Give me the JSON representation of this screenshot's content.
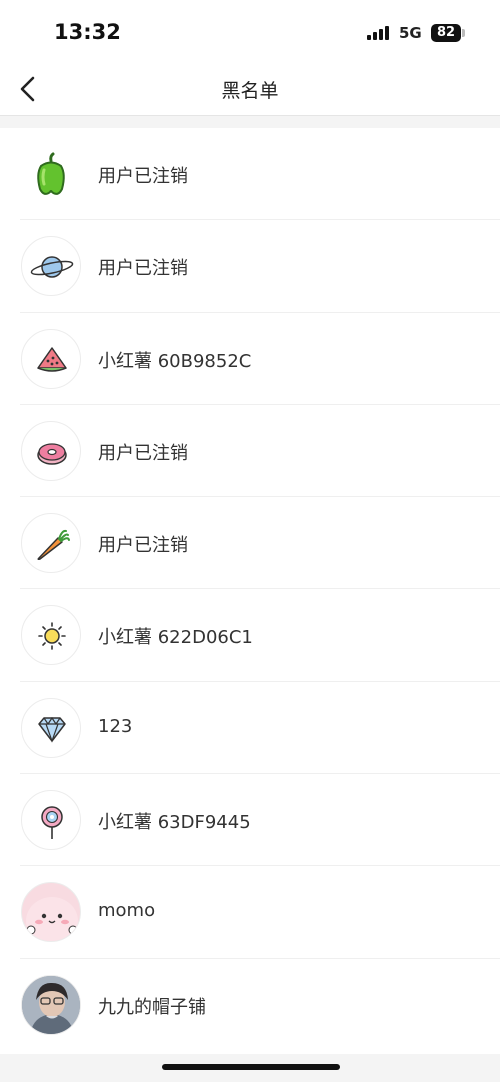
{
  "status_bar": {
    "time": "13:32",
    "network": "5G",
    "battery": "82"
  },
  "nav": {
    "title": "黑名单",
    "back_icon": "chevron-left-icon"
  },
  "blocked_users": [
    {
      "name": "用户已注销",
      "avatar_icon": "green-pepper-icon"
    },
    {
      "name": "用户已注销",
      "avatar_icon": "planet-icon"
    },
    {
      "name": "小红薯 60B9852C",
      "avatar_icon": "watermelon-icon"
    },
    {
      "name": "用户已注销",
      "avatar_icon": "donut-icon"
    },
    {
      "name": "用户已注销",
      "avatar_icon": "carrot-icon"
    },
    {
      "name": "小红薯 622D06C1",
      "avatar_icon": "sun-icon"
    },
    {
      "name": "123",
      "avatar_icon": "diamond-icon"
    },
    {
      "name": "小红薯 63DF9445",
      "avatar_icon": "lollipop-icon"
    },
    {
      "name": "momo",
      "avatar_icon": "pink-character-photo"
    },
    {
      "name": "九九的帽子铺",
      "avatar_icon": "person-photo"
    }
  ]
}
